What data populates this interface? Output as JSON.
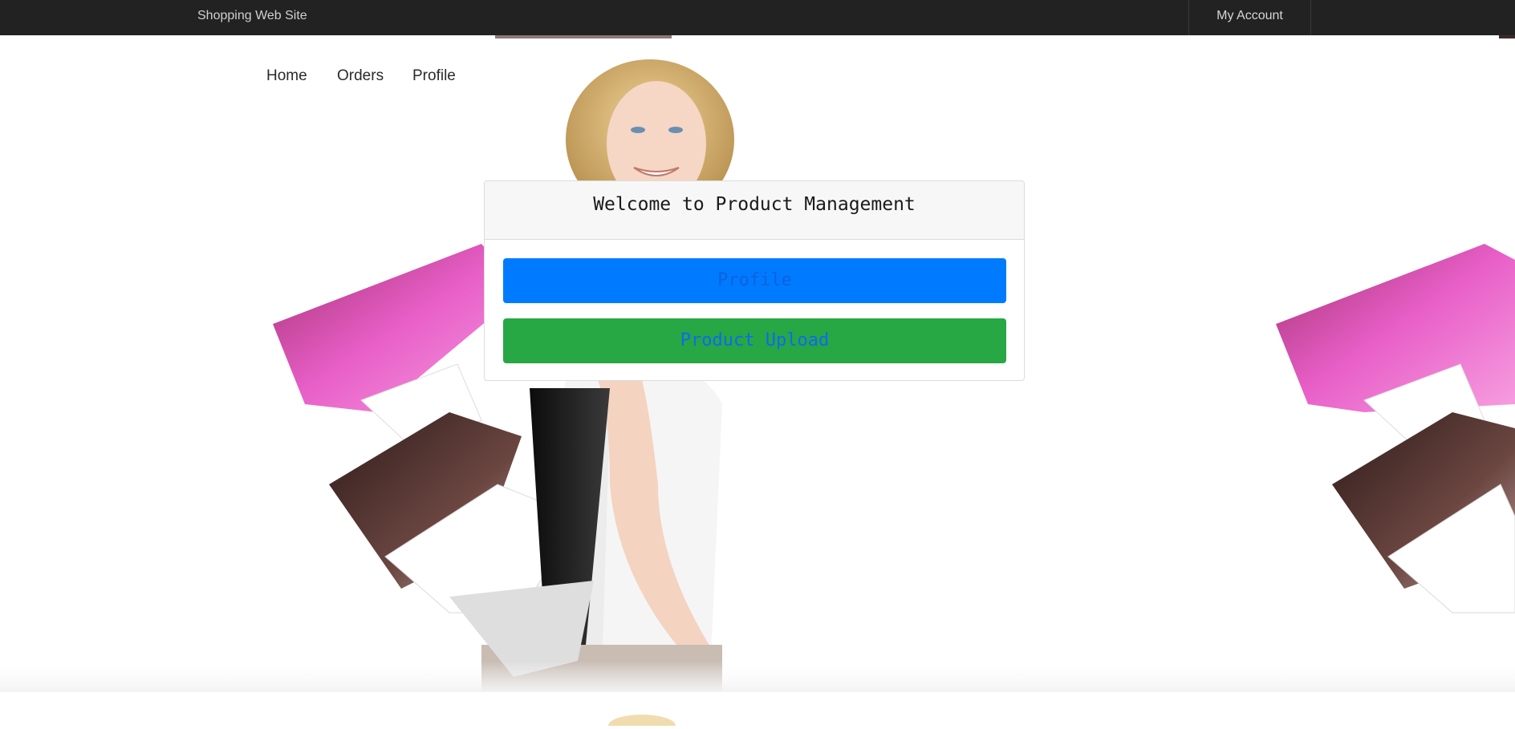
{
  "header": {
    "brand": "Shopping Web Site",
    "account_label": "My Account"
  },
  "nav": {
    "items": [
      "Home",
      "Orders",
      "Profile"
    ]
  },
  "card": {
    "title": "Welcome to Product Management",
    "profile_button": "Profile",
    "upload_button": "Product Upload"
  },
  "colors": {
    "topbar": "#222222",
    "primary_button": "#007bff",
    "success_button": "#28a745",
    "bag_pink": "#e85fc8",
    "bag_brown": "#4a2f2c"
  }
}
